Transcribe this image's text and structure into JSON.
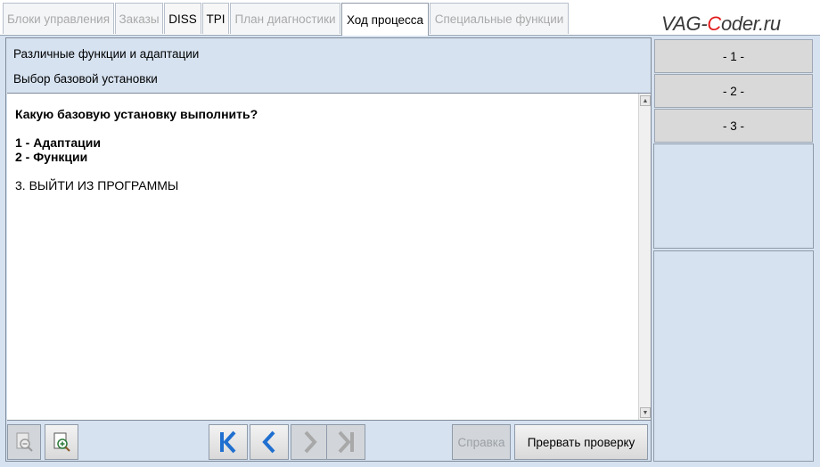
{
  "tabs": [
    {
      "label": "Блоки управления",
      "state": "disabled"
    },
    {
      "label": "Заказы",
      "state": "disabled"
    },
    {
      "label": "DISS",
      "state": "enabled"
    },
    {
      "label": "TPI",
      "state": "enabled"
    },
    {
      "label": "План диагностики",
      "state": "disabled"
    },
    {
      "label": "Ход процесса",
      "state": "active"
    },
    {
      "label": "Специальные функции",
      "state": "disabled"
    }
  ],
  "watermark": {
    "part1": "VAG-",
    "accent": "C",
    "part2": "oder.ru"
  },
  "header": {
    "line1": "Различные функции и адаптации",
    "line2": "Выбор базовой установки"
  },
  "content": {
    "question": "Какую базовую установку выполнить?",
    "option1": "1 - Адаптации",
    "option2": "2 - Функции",
    "option3": "3. ВЫЙТИ ИЗ ПРОГРАММЫ"
  },
  "side_buttons": [
    "- 1 -",
    "- 2 -",
    "- 3 -"
  ],
  "toolbar": {
    "help_label": "Справка",
    "abort_label": "Прервать проверку"
  },
  "icons": {
    "zoom_out": "zoom-out-icon",
    "zoom_in": "zoom-in-icon",
    "first": "skip-to-start-icon",
    "back": "back-icon",
    "forward": "forward-icon",
    "last": "skip-to-end-icon"
  },
  "colors": {
    "background": "#d6e2f0",
    "nav_active": "#1f6fd0",
    "nav_disabled": "#a8a8a8",
    "watermark_accent": "#e21c1c"
  }
}
